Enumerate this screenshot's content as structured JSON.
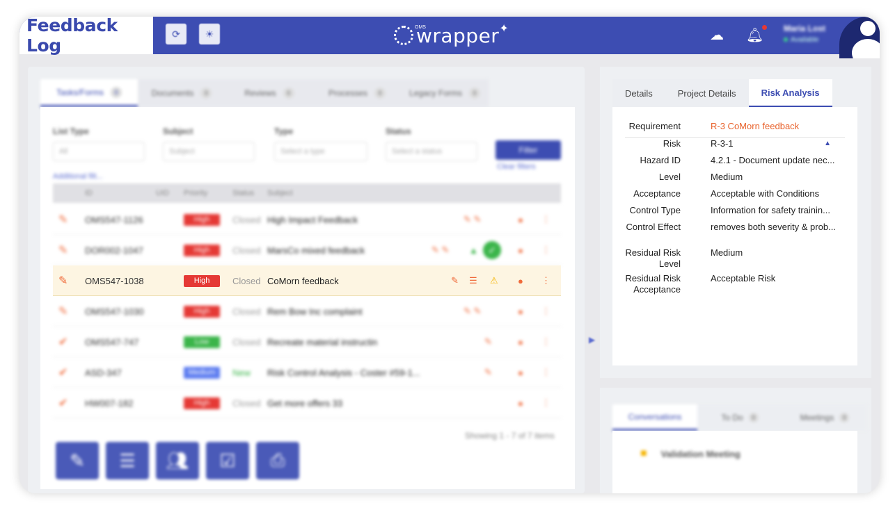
{
  "header": {
    "title": "Feedback Log",
    "logo_text": "wrapper",
    "logo_sup": "OMS",
    "user_name": "Maria Lost",
    "user_status": "Available"
  },
  "list": {
    "tabs": [
      {
        "label": "Tasks/Forms",
        "count": "0"
      },
      {
        "label": "Documents",
        "count": "0"
      },
      {
        "label": "Reviews",
        "count": "0"
      },
      {
        "label": "Processes",
        "count": "0"
      },
      {
        "label": "Legacy Forms",
        "count": "0"
      }
    ],
    "filters": {
      "list_type_label": "List Type",
      "list_type_value": "All",
      "subject_label": "Subject",
      "subject_placeholder": "Subject",
      "type_label": "Type",
      "type_placeholder": "Select a type",
      "status_label": "Status",
      "status_placeholder": "Select a status",
      "filter_button": "Filter",
      "clear_filters": "Clear filters",
      "additional_filters": "Additional filt..."
    },
    "columns": [
      "ID",
      "UID",
      "Priority",
      "Status",
      "Subject"
    ],
    "rows": [
      {
        "id": "OMS547-1126",
        "priority": "High",
        "status": "Closed",
        "subject": "High Impact Feedback"
      },
      {
        "id": "DOR002-1047",
        "priority": "High",
        "status": "Closed",
        "subject": "MarsCo mixed feedback"
      },
      {
        "id": "OMS547-1038",
        "priority": "High",
        "status": "Closed",
        "subject": "CoMorn feedback"
      },
      {
        "id": "OMS547-1030",
        "priority": "High",
        "status": "Closed",
        "subject": "Rem Bow Inc complaint"
      },
      {
        "id": "OMS547-747",
        "priority": "Low",
        "status": "Closed",
        "subject": "Recreate material instructin"
      },
      {
        "id": "ASD-347",
        "priority": "Medium",
        "status": "New",
        "subject": "Risk Control Analysis - Coster #59-1..."
      },
      {
        "id": "HW007-182",
        "priority": "High",
        "status": "Closed",
        "subject": "Get more offers 33"
      }
    ],
    "showing": "Showing 1 - 7 of 7 items"
  },
  "details": {
    "tabs": [
      "Details",
      "Project Details",
      "Risk Analysis"
    ],
    "fields": [
      {
        "key": "Requirement",
        "value": "R-3 CoMorn feedback"
      },
      {
        "key": "Risk",
        "value": "R-3-1"
      },
      {
        "key": "Hazard ID",
        "value": "4.2.1 - Document update nec..."
      },
      {
        "key": "Level",
        "value": "Medium"
      },
      {
        "key": "Acceptance",
        "value": "Acceptable with Conditions"
      },
      {
        "key": "Control Type",
        "value": "Information for safety trainin..."
      },
      {
        "key": "Control Effect",
        "value": "removes both severity & prob..."
      },
      {
        "key": "Residual Risk Level",
        "value": "Medium"
      },
      {
        "key": "Residual Risk Acceptance",
        "value": "Acceptable Risk"
      }
    ]
  },
  "bottom": {
    "tabs": [
      {
        "label": "Conversations",
        "count": ""
      },
      {
        "label": "To Do",
        "count": "0"
      },
      {
        "label": "Meetings",
        "count": "0"
      }
    ],
    "item": "Validation Meeting"
  },
  "colors": {
    "brand": "#3d4db2",
    "high": "#e53935",
    "low": "#3bb54a",
    "medium": "#5b7bf0",
    "accent": "#f06a3a"
  }
}
